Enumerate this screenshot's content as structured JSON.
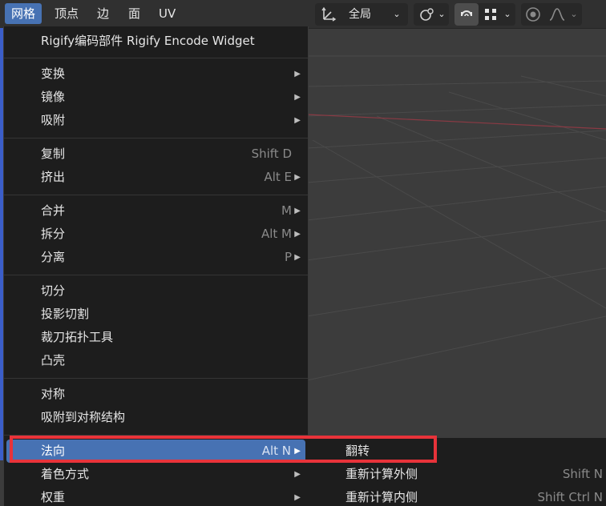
{
  "header": {
    "tabs": [
      "网格",
      "顶点",
      "边",
      "面",
      "UV"
    ],
    "active_tab_index": 0,
    "transform_orientation": "全局"
  },
  "menu": {
    "items": [
      {
        "label": "Rigify编码部件  Rigify Encode Widget",
        "shortcut": "",
        "submenu": false
      },
      {
        "label": "变换",
        "shortcut": "",
        "submenu": true
      },
      {
        "label": "镜像",
        "shortcut": "",
        "submenu": true
      },
      {
        "label": "吸附",
        "shortcut": "",
        "submenu": true
      },
      {
        "label": "复制",
        "shortcut": "Shift D",
        "submenu": false
      },
      {
        "label": "挤出",
        "shortcut": "Alt E",
        "submenu": true
      },
      {
        "label": "合并",
        "shortcut": "M",
        "submenu": true
      },
      {
        "label": "拆分",
        "shortcut": "Alt M",
        "submenu": true
      },
      {
        "label": "分离",
        "shortcut": "P",
        "submenu": true
      },
      {
        "label": "切分",
        "shortcut": "",
        "submenu": false
      },
      {
        "label": "投影切割",
        "shortcut": "",
        "submenu": false
      },
      {
        "label": "裁刀拓扑工具",
        "shortcut": "",
        "submenu": false
      },
      {
        "label": "凸壳",
        "shortcut": "",
        "submenu": false
      },
      {
        "label": "对称",
        "shortcut": "",
        "submenu": false
      },
      {
        "label": "吸附到对称结构",
        "shortcut": "",
        "submenu": false
      },
      {
        "label": "法向",
        "shortcut": "Alt N",
        "submenu": true
      },
      {
        "label": "着色方式",
        "shortcut": "",
        "submenu": true
      },
      {
        "label": "权重",
        "shortcut": "",
        "submenu": true
      }
    ]
  },
  "submenu": {
    "items": [
      {
        "label": "翻转",
        "shortcut": ""
      },
      {
        "label": "重新计算外侧",
        "shortcut": "Shift N"
      },
      {
        "label": "重新计算内侧",
        "shortcut": "Shift Ctrl N"
      }
    ]
  },
  "colors": {
    "accent": "#4772b3",
    "annotation": "#e8333a",
    "menu_bg": "#1d1d1d"
  }
}
